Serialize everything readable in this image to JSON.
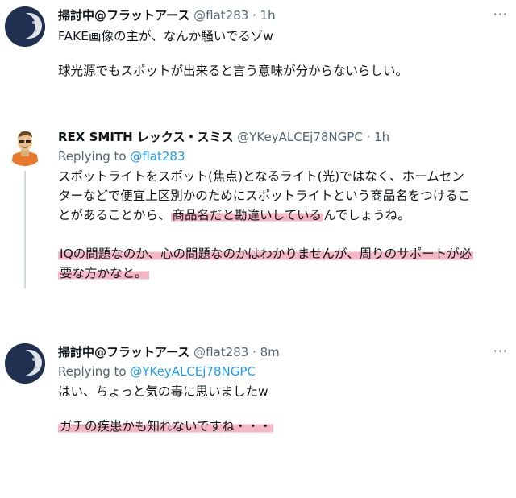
{
  "tweets": [
    {
      "name": "掃討中@フラットアース",
      "handle": "@flat283",
      "dot": "·",
      "time": "1h",
      "lines": [
        "FAKE画像の主が、なんか騒いでるゾw",
        "球光源でもスポットが出来ると言う意味が分からないらしい。"
      ]
    },
    {
      "name": "REX SMITH レックス・スミス",
      "handle": "@YKeyALCEj78NGPC",
      "dot": "·",
      "time": "1h",
      "reply_prefix": "Replying to ",
      "reply_target": "@flat283",
      "para1_line1": "スポットライトをスポット(焦点)となるライト(光)ではなく、ホームセン",
      "para1_line2": "ターなどで便宜上区別かのためにスポットライトという商品名をつけるこ",
      "para1_line3_a": "とがあることから、",
      "para1_line3_hl": "商品名だと勘違いしている",
      "para1_line3_b": "んでしょうね。",
      "para2_line1": "IQの問題なのか、心の問題なのかはわかりませんが、周りのサポートが必",
      "para2_line2": "要な方かなと。"
    },
    {
      "name": "掃討中@フラットアース",
      "handle": "@flat283",
      "dot": "·",
      "time": "8m",
      "reply_prefix": "Replying to ",
      "reply_target": "@YKeyALCEj78NGPC",
      "line1": "はい、ちょっと気の毒に思いましたw",
      "line2": "ガチの疾患かも知れないですね・・・"
    }
  ],
  "more_label": "···",
  "colors": {
    "link": "#1d9bf0",
    "secondary": "#536471",
    "highlight": "#f5b6c6"
  }
}
